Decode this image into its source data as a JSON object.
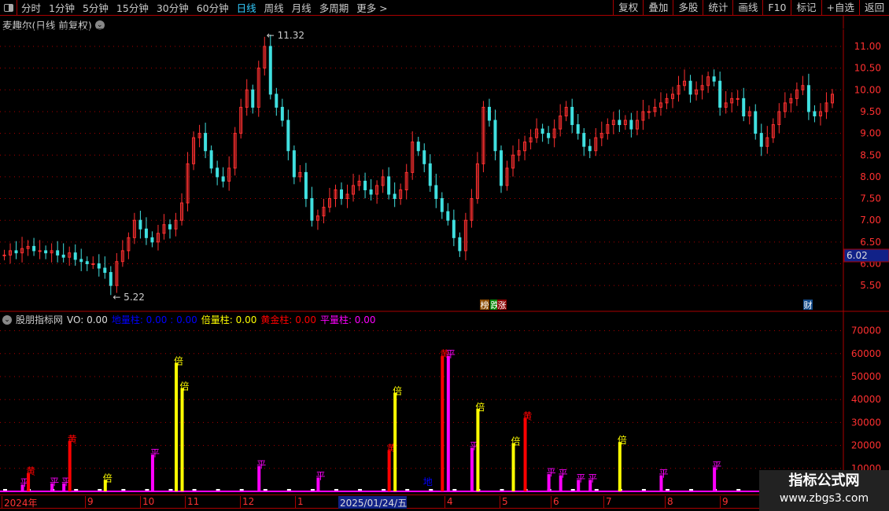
{
  "toolbar": {
    "periods": [
      "分时",
      "1分钟",
      "5分钟",
      "15分钟",
      "30分钟",
      "60分钟",
      "日线",
      "周线",
      "月线",
      "多周期",
      "更多 >"
    ],
    "active": "日线",
    "buttons": [
      "复权",
      "叠加",
      "多股",
      "统计",
      "画线",
      "F10",
      "标记",
      "+自选",
      "返回"
    ]
  },
  "main": {
    "title": "麦趣尔(日线 前复权)",
    "high_label": "11.32",
    "low_label": "5.22",
    "current_price": "6.02",
    "price_ticks": [
      "11.00",
      "10.50",
      "10.00",
      "9.50",
      "9.00",
      "8.50",
      "8.00",
      "7.50",
      "7.00",
      "6.50",
      "6.00",
      "5.50"
    ],
    "tags": [
      "榜",
      "跌",
      "涨",
      "财"
    ]
  },
  "indicator": {
    "name": "股朋指标网",
    "vo": "VO: 0.00",
    "di": "地量柱: 0.00 : 0.00",
    "bei": "倍量柱: 0.00",
    "huang": "黄金柱: 0.00",
    "ping": "平量柱: 0.00",
    "ticks": [
      "70000",
      "60000",
      "50000",
      "40000",
      "30000",
      "20000",
      "10000"
    ]
  },
  "dates": [
    "2024年",
    "9",
    "10",
    "11",
    "12",
    "1",
    "2025/01/24/五",
    "4",
    "5",
    "6",
    "7",
    "8",
    "9"
  ],
  "watermark": {
    "line1": "指标公式网",
    "line2": "www.zbgs3.com"
  },
  "colors": {
    "up": "#ff3030",
    "down": "#40e0e0",
    "ping": "#ff00ff",
    "bei": "#ffff00",
    "huang": "#ff0000",
    "di": "#0000ff",
    "axis": "#ff3030"
  },
  "chart_data": {
    "type": "candlestick+bar",
    "closes": [
      6.2,
      6.3,
      6.25,
      6.35,
      6.4,
      6.3,
      6.3,
      6.25,
      6.3,
      6.2,
      6.15,
      6.25,
      6.1,
      6.05,
      6.0,
      6.0,
      5.9,
      5.8,
      5.5,
      6.05,
      6.3,
      6.6,
      7.0,
      6.8,
      6.6,
      6.5,
      6.7,
      6.9,
      6.8,
      7.0,
      7.4,
      8.3,
      8.9,
      9.0,
      8.6,
      8.2,
      8.0,
      7.9,
      8.2,
      9.0,
      9.6,
      10.0,
      9.6,
      10.5,
      11.0,
      9.9,
      9.6,
      9.3,
      8.6,
      8.0,
      8.1,
      7.5,
      7.0,
      7.1,
      7.3,
      7.5,
      7.7,
      7.5,
      7.6,
      7.8,
      7.9,
      7.7,
      7.6,
      7.8,
      8.0,
      7.6,
      7.5,
      7.7,
      8.1,
      8.8,
      8.6,
      8.3,
      7.8,
      7.5,
      7.2,
      7.0,
      6.6,
      6.3,
      7.0,
      7.5,
      8.3,
      9.6,
      9.3,
      8.6,
      7.8,
      8.2,
      8.5,
      8.6,
      8.8,
      8.9,
      9.1,
      9.0,
      8.9,
      9.1,
      9.4,
      9.6,
      9.2,
      9.0,
      8.7,
      8.6,
      8.9,
      9.0,
      9.2,
      9.3,
      9.2,
      9.3,
      9.1,
      9.3,
      9.5,
      9.5,
      9.6,
      9.7,
      9.8,
      9.9,
      10.1,
      10.2,
      9.9,
      10.0,
      10.1,
      10.3,
      10.2,
      9.6,
      9.7,
      9.8,
      9.8,
      9.4,
      9.5,
      9.0,
      8.7,
      8.9,
      9.2,
      9.5,
      9.7,
      9.8,
      10.0,
      10.1,
      9.5,
      9.4,
      9.5,
      9.7,
      9.9
    ],
    "volume_bars": [
      {
        "i": 3,
        "v": 3000,
        "t": "ping"
      },
      {
        "i": 4,
        "v": 8000,
        "t": "huang"
      },
      {
        "i": 8,
        "v": 3500,
        "t": "ping"
      },
      {
        "i": 10,
        "v": 3500,
        "t": "ping"
      },
      {
        "i": 11,
        "v": 22000,
        "t": "huang"
      },
      {
        "i": 17,
        "v": 5000,
        "t": "bei"
      },
      {
        "i": 25,
        "v": 16000,
        "t": "ping"
      },
      {
        "i": 29,
        "v": 56000,
        "t": "bei"
      },
      {
        "i": 30,
        "v": 45000,
        "t": "bei"
      },
      {
        "i": 43,
        "v": 11000,
        "t": "ping"
      },
      {
        "i": 53,
        "v": 6000,
        "t": "ping"
      },
      {
        "i": 65,
        "v": 18000,
        "t": "huang"
      },
      {
        "i": 66,
        "v": 43000,
        "t": "bei"
      },
      {
        "i": 71,
        "v": 0,
        "t": "di"
      },
      {
        "i": 74,
        "v": 59000,
        "t": "huang"
      },
      {
        "i": 75,
        "v": 59000,
        "t": "ping"
      },
      {
        "i": 79,
        "v": 19000,
        "t": "ping"
      },
      {
        "i": 80,
        "v": 36000,
        "t": "bei"
      },
      {
        "i": 86,
        "v": 21000,
        "t": "bei"
      },
      {
        "i": 88,
        "v": 32000,
        "t": "huang"
      },
      {
        "i": 92,
        "v": 7500,
        "t": "ping"
      },
      {
        "i": 94,
        "v": 7000,
        "t": "ping"
      },
      {
        "i": 97,
        "v": 5000,
        "t": "ping"
      },
      {
        "i": 99,
        "v": 5000,
        "t": "ping"
      },
      {
        "i": 104,
        "v": 21500,
        "t": "bei"
      },
      {
        "i": 111,
        "v": 7000,
        "t": "ping"
      },
      {
        "i": 120,
        "v": 10500,
        "t": "ping"
      }
    ],
    "labels": {
      "ping": "平",
      "bei": "倍",
      "huang": "黄",
      "di": "地"
    },
    "price_range": [
      5.2,
      11.4
    ],
    "volume_range": [
      0,
      75000
    ]
  }
}
